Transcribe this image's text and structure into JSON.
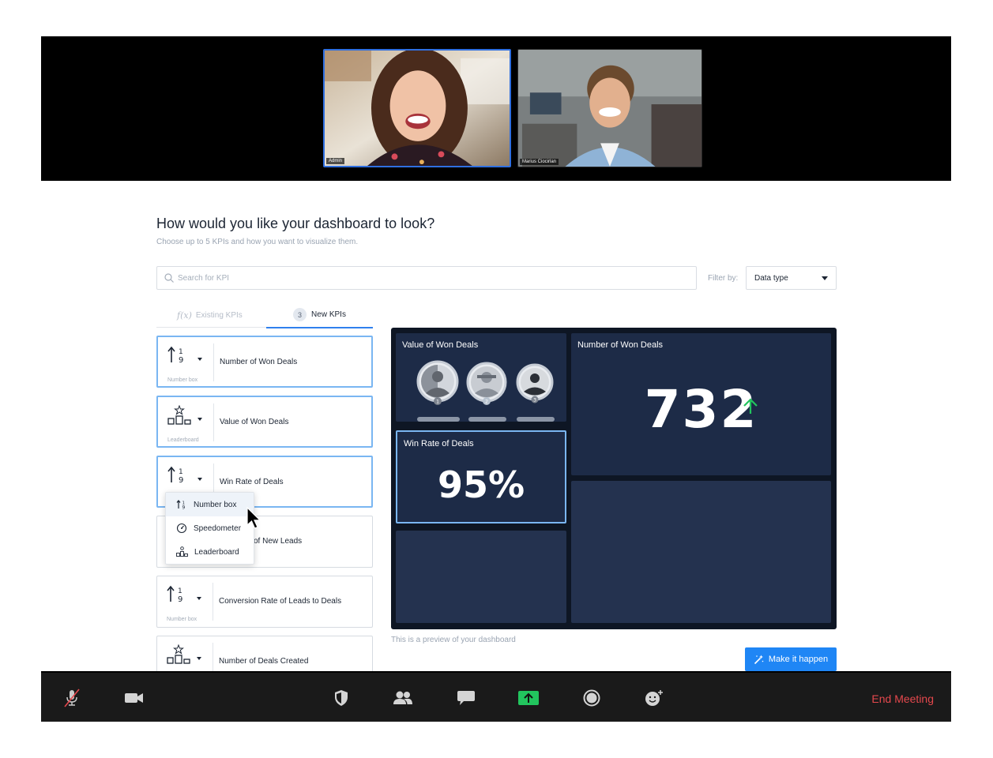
{
  "meeting": {
    "participants": [
      {
        "name": "Admin"
      },
      {
        "name": "Marius Ciocirlan"
      }
    ],
    "end_label": "End Meeting"
  },
  "page": {
    "title": "How would you like your dashboard to look?",
    "subtitle": "Choose up to 5 KPIs and how you want to visualize them."
  },
  "search": {
    "placeholder": "Search for KPI"
  },
  "filter": {
    "label": "Filter by:",
    "value": "Data type"
  },
  "tabs": {
    "existing": {
      "icon": "f(x)",
      "label": "Existing KPIs"
    },
    "new": {
      "count": "3",
      "label": "New KPIs"
    }
  },
  "kpis": [
    {
      "name": "Number of Won Deals",
      "visual": "Number box",
      "icon": "number-box-icon"
    },
    {
      "name": "Value of Won Deals",
      "visual": "Leaderboard",
      "icon": "leaderboard-icon"
    },
    {
      "name": "Win Rate of Deals",
      "visual": "",
      "icon": "number-box-icon"
    },
    {
      "name": "of New Leads",
      "visual": "",
      "icon": ""
    },
    {
      "name": "Conversion Rate of Leads to Deals",
      "visual": "Number box",
      "icon": "number-box-icon"
    },
    {
      "name": "Number of Deals Created",
      "visual": "",
      "icon": "leaderboard-icon"
    }
  ],
  "dropdown": {
    "options": [
      {
        "label": "Number box",
        "icon": "number-box-icon"
      },
      {
        "label": "Speedometer",
        "icon": "speedometer-icon"
      },
      {
        "label": "Leaderboard",
        "icon": "leaderboard-icon"
      }
    ],
    "highlighted": "Number box"
  },
  "preview": {
    "widgets": {
      "value_won": {
        "title": "Value of Won Deals",
        "ranks": [
          "1",
          "2",
          "3"
        ]
      },
      "number_won": {
        "title": "Number of Won Deals",
        "value": "732",
        "trend": "up"
      },
      "win_rate": {
        "title": "Win Rate of Deals",
        "value": "95%"
      }
    },
    "note": "This is a preview of your dashboard"
  },
  "cta": {
    "label": "Make it happen"
  },
  "colors": {
    "accent": "#1f86f5",
    "preview_bg": "#0e1624",
    "widget_bg": "#1d2b47",
    "selected_border": "#7ab6f2",
    "trend_up": "#22c55e",
    "end_meeting": "#e5484d",
    "share_green": "#22c55e"
  }
}
